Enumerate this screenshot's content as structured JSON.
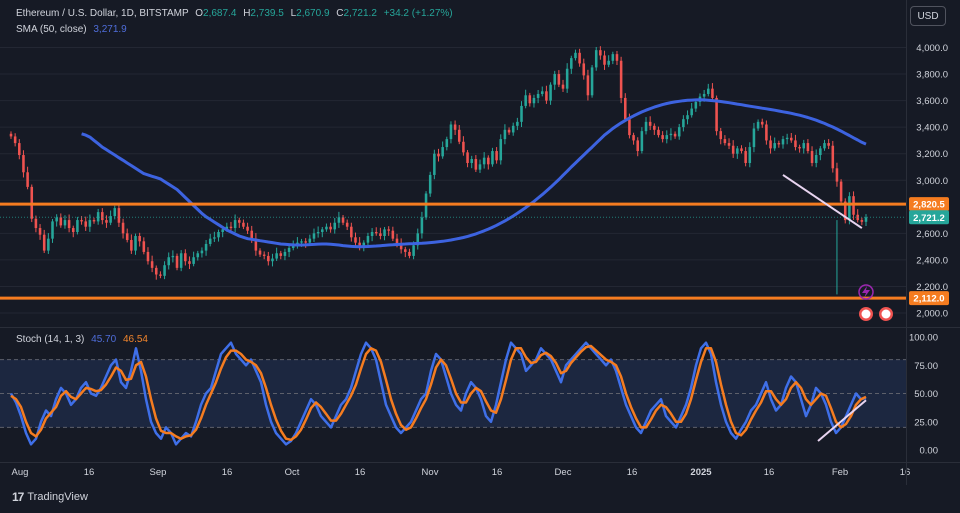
{
  "header": {
    "symbol": "Ethereum / U.S. Dollar, 1D, BITSTAMP",
    "open_label": "O",
    "open": "2,687.4",
    "high_label": "H",
    "high": "2,739.5",
    "low_label": "L",
    "low": "2,670.9",
    "close_label": "C",
    "close": "2,721.2",
    "change": "+34.2 (+1.27%)",
    "sma_label": "SMA (50, close)",
    "sma_value": "3,271.9"
  },
  "currency_button": "USD",
  "stoch_legend": {
    "label": "Stoch (14, 1, 3)",
    "k": "45.70",
    "d": "46.54"
  },
  "branding": {
    "mark": "17",
    "name": "TradingView"
  },
  "colors": {
    "up": "#26a69a",
    "down": "#ef5350",
    "sma": "#3d63e0",
    "orange": "#f57c20",
    "trend": "#e8d4f0",
    "k_line": "#3f6fe8",
    "d_line": "#f57c20"
  },
  "chart_data": [
    {
      "type": "candlestick",
      "title": "Ethereum / U.S. Dollar, 1D, BITSTAMP",
      "x_ticks": [
        "Aug",
        "16",
        "Sep",
        "16",
        "Oct",
        "16",
        "Nov",
        "16",
        "Dec",
        "16",
        "2025",
        "16",
        "Feb",
        "16"
      ],
      "y_ticks": [
        "4,000.0",
        "3,800.0",
        "3,600.0",
        "3,400.0",
        "3,200.0",
        "3,000.0",
        "2,600.0",
        "2,400.0",
        "2,200.0",
        "2,000.0"
      ],
      "ylim": [
        1950,
        4130
      ],
      "price_labels": [
        "2,820.5",
        "2,721.2",
        "2,112.0"
      ],
      "horizontal_levels": [
        2820.5,
        2112.0
      ],
      "last_close": 2721.2,
      "close_series": [
        3330,
        3280,
        3190,
        3060,
        2950,
        2710,
        2640,
        2590,
        2470,
        2560,
        2690,
        2720,
        2660,
        2700,
        2640,
        2610,
        2700,
        2690,
        2650,
        2700,
        2690,
        2760,
        2700,
        2680,
        2730,
        2790,
        2680,
        2600,
        2550,
        2470,
        2580,
        2540,
        2460,
        2390,
        2340,
        2290,
        2280,
        2360,
        2420,
        2430,
        2340,
        2450,
        2390,
        2370,
        2420,
        2450,
        2470,
        2520,
        2560,
        2570,
        2610,
        2630,
        2650,
        2640,
        2700,
        2680,
        2650,
        2620,
        2560,
        2470,
        2440,
        2430,
        2390,
        2410,
        2450,
        2430,
        2460,
        2490,
        2510,
        2530,
        2540,
        2530,
        2560,
        2600,
        2610,
        2630,
        2650,
        2630,
        2680,
        2720,
        2680,
        2650,
        2570,
        2530,
        2490,
        2530,
        2580,
        2610,
        2600,
        2580,
        2630,
        2620,
        2560,
        2520,
        2480,
        2460,
        2430,
        2510,
        2600,
        2720,
        2900,
        3040,
        3200,
        3180,
        3250,
        3310,
        3420,
        3380,
        3290,
        3210,
        3130,
        3160,
        3080,
        3120,
        3170,
        3120,
        3220,
        3150,
        3310,
        3380,
        3360,
        3410,
        3440,
        3560,
        3640,
        3580,
        3620,
        3650,
        3670,
        3600,
        3720,
        3800,
        3720,
        3690,
        3840,
        3920,
        3960,
        3880,
        3790,
        3640,
        3850,
        3980,
        3940,
        3870,
        3900,
        3950,
        3900,
        3620,
        3460,
        3340,
        3300,
        3220,
        3370,
        3440,
        3410,
        3380,
        3340,
        3310,
        3340,
        3350,
        3330,
        3400,
        3460,
        3490,
        3540,
        3590,
        3630,
        3650,
        3690,
        3620,
        3370,
        3310,
        3280,
        3260,
        3200,
        3240,
        3220,
        3130,
        3250,
        3390,
        3440,
        3420,
        3300,
        3240,
        3280,
        3270,
        3310,
        3320,
        3300,
        3250,
        3240,
        3280,
        3220,
        3130,
        3190,
        3240,
        3280,
        3260,
        3090,
        2990,
        2840,
        2700,
        2880,
        2740,
        2700,
        2687,
        2721
      ],
      "sma_50": [
        3350,
        3340,
        3325,
        3300,
        3275,
        3250,
        3230,
        3210,
        3190,
        3170,
        3150,
        3130,
        3110,
        3090,
        3070,
        3050,
        3040,
        3030,
        3020,
        3010,
        2990,
        2970,
        2950,
        2930,
        2900,
        2870,
        2840,
        2810,
        2780,
        2750,
        2725,
        2705,
        2685,
        2665,
        2645,
        2625,
        2610,
        2595,
        2580,
        2570,
        2560,
        2555,
        2550,
        2545,
        2540,
        2535,
        2530,
        2525,
        2520,
        2518,
        2515,
        2513,
        2512,
        2512,
        2513,
        2515,
        2517,
        2519,
        2520,
        2520,
        2518,
        2515,
        2512,
        2508,
        2505,
        2502,
        2500,
        2499,
        2500,
        2501,
        2503,
        2505,
        2507,
        2509,
        2512,
        2514,
        2516,
        2518,
        2520,
        2522,
        2523,
        2524,
        2525,
        2527,
        2530,
        2533,
        2537,
        2540,
        2545,
        2550,
        2556,
        2562,
        2569,
        2577,
        2586,
        2596,
        2607,
        2619,
        2632,
        2646,
        2661,
        2677,
        2694,
        2712,
        2731,
        2751,
        2772,
        2794,
        2817,
        2841,
        2866,
        2892,
        2919,
        2947,
        2976,
        3006,
        3037,
        3068,
        3100,
        3130,
        3160,
        3190,
        3220,
        3250,
        3280,
        3310,
        3340,
        3365,
        3390,
        3412,
        3432,
        3451,
        3468,
        3485,
        3500,
        3515,
        3528,
        3540,
        3551,
        3561,
        3570,
        3578,
        3585,
        3590,
        3595,
        3599,
        3602,
        3604,
        3605,
        3606,
        3605,
        3603,
        3600,
        3597,
        3593,
        3589,
        3584,
        3579,
        3574,
        3569,
        3563,
        3558,
        3553,
        3548,
        3543,
        3538,
        3533,
        3528,
        3522,
        3516,
        3510,
        3504,
        3497,
        3490,
        3482,
        3473,
        3463,
        3452,
        3440,
        3428,
        3415,
        3401,
        3386,
        3370,
        3354,
        3337,
        3320,
        3303,
        3286,
        3272
      ]
    },
    {
      "type": "line",
      "title": "Stoch (14, 1, 3)",
      "y_ticks": [
        "100.00",
        "75.00",
        "50.00",
        "25.00",
        "0.00"
      ],
      "ylim": [
        0,
        100
      ],
      "band": [
        20,
        80
      ],
      "series": [
        {
          "name": "45.70",
          "values": [
            50,
            42,
            30,
            15,
            5,
            10,
            25,
            35,
            30,
            45,
            55,
            50,
            40,
            45,
            55,
            60,
            50,
            48,
            55,
            65,
            75,
            80,
            60,
            55,
            70,
            90,
            70,
            45,
            25,
            15,
            10,
            20,
            15,
            5,
            10,
            15,
            12,
            25,
            40,
            50,
            55,
            70,
            85,
            90,
            95,
            85,
            80,
            75,
            80,
            70,
            60,
            40,
            25,
            15,
            10,
            5,
            8,
            15,
            25,
            35,
            45,
            40,
            30,
            25,
            20,
            30,
            40,
            45,
            55,
            70,
            85,
            95,
            90,
            80,
            60,
            40,
            30,
            20,
            15,
            20,
            25,
            35,
            45,
            50,
            70,
            85,
            80,
            65,
            50,
            40,
            35,
            50,
            60,
            55,
            45,
            30,
            25,
            40,
            60,
            80,
            95,
            90,
            85,
            70,
            75,
            80,
            90,
            85,
            80,
            70,
            60,
            75,
            80,
            85,
            90,
            95,
            90,
            85,
            80,
            75,
            80,
            70,
            55,
            40,
            30,
            20,
            15,
            25,
            35,
            40,
            45,
            30,
            25,
            20,
            30,
            40,
            55,
            75,
            90,
            95,
            85,
            60,
            40,
            25,
            15,
            10,
            18,
            25,
            35,
            40,
            50,
            60,
            45,
            35,
            40,
            55,
            65,
            60,
            45,
            30,
            40,
            55,
            50,
            40,
            25,
            15,
            20,
            30,
            40,
            50,
            45,
            46
          ]
        },
        {
          "name": "46.54",
          "values": [
            48,
            45,
            38,
            25,
            15,
            12,
            18,
            28,
            33,
            38,
            48,
            52,
            47,
            45,
            50,
            55,
            54,
            52,
            53,
            58,
            65,
            73,
            70,
            62,
            63,
            75,
            78,
            65,
            45,
            28,
            17,
            15,
            15,
            12,
            10,
            12,
            13,
            18,
            28,
            40,
            50,
            60,
            72,
            82,
            88,
            88,
            85,
            80,
            78,
            75,
            68,
            55,
            40,
            27,
            17,
            10,
            9,
            12,
            18,
            27,
            37,
            42,
            38,
            32,
            26,
            26,
            32,
            40,
            48,
            58,
            72,
            85,
            90,
            88,
            78,
            62,
            45,
            32,
            22,
            18,
            20,
            28,
            37,
            45,
            58,
            73,
            80,
            75,
            63,
            50,
            42,
            42,
            50,
            55,
            52,
            43,
            35,
            33,
            45,
            62,
            80,
            90,
            90,
            82,
            77,
            78,
            84,
            86,
            83,
            77,
            68,
            70,
            77,
            82,
            87,
            91,
            92,
            88,
            84,
            80,
            78,
            75,
            65,
            50,
            38,
            28,
            20,
            20,
            27,
            35,
            40,
            38,
            32,
            25,
            25,
            32,
            45,
            62,
            78,
            90,
            90,
            78,
            58,
            40,
            25,
            15,
            13,
            18,
            27,
            35,
            42,
            52,
            52,
            45,
            40,
            45,
            55,
            60,
            55,
            45,
            40,
            45,
            50,
            48,
            37,
            25,
            20,
            23,
            30,
            40,
            45,
            47
          ]
        }
      ]
    }
  ]
}
